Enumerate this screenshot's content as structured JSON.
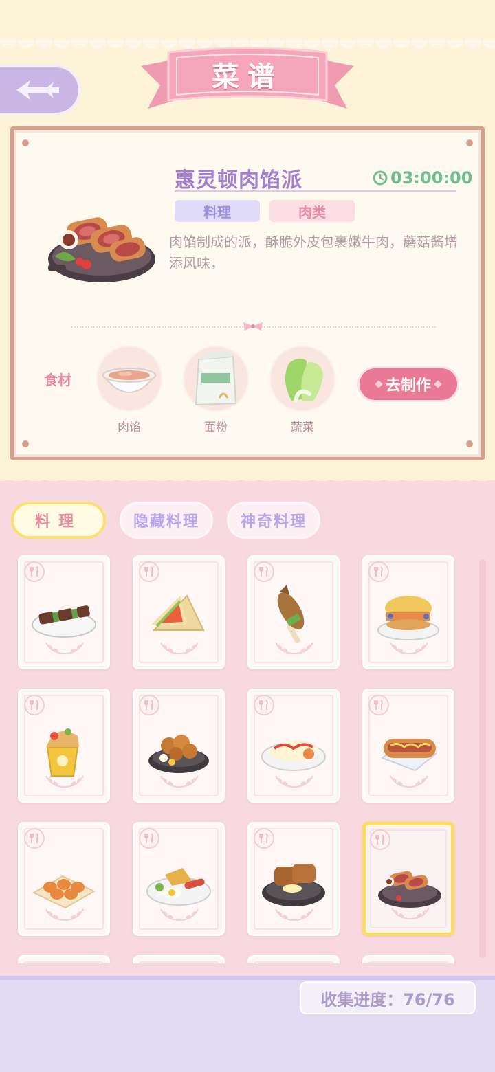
{
  "header": {
    "title": "菜谱"
  },
  "detail": {
    "dish_name": "惠灵顿肉馅派",
    "timer": "03:00:00",
    "tag_type": "料理",
    "tag_category": "肉类",
    "description": "肉馅制成的派，酥脆外皮包裹嫩牛肉，蘑菇酱增添风味，",
    "ingredients_label": "食材",
    "ingredients": [
      {
        "name": "肉馅",
        "icon": "minced-meat-bowl-icon"
      },
      {
        "name": "面粉",
        "icon": "flour-bag-icon"
      },
      {
        "name": "蔬菜",
        "icon": "cabbage-icon"
      }
    ],
    "make_button": "去制作"
  },
  "tabs": [
    {
      "label": "料理",
      "active": true
    },
    {
      "label": "隐藏料理",
      "active": false
    },
    {
      "label": "神奇料理",
      "active": false
    }
  ],
  "recipes": [
    {
      "icon": "kebab-skewers-icon"
    },
    {
      "icon": "sandwich-icon"
    },
    {
      "icon": "grilled-fish-skewer-icon"
    },
    {
      "icon": "burger-icon"
    },
    {
      "icon": "wrap-icon"
    },
    {
      "icon": "fried-chicken-icon"
    },
    {
      "icon": "omelette-icon"
    },
    {
      "icon": "hotdog-icon"
    },
    {
      "icon": "bacon-rolls-icon"
    },
    {
      "icon": "breakfast-plate-icon"
    },
    {
      "icon": "cutlet-icon"
    },
    {
      "icon": "wellington-icon",
      "selected": true
    }
  ],
  "progress": {
    "text": "收集进度：76/76",
    "collected": 76,
    "total": 76
  },
  "colors": {
    "accent_pink": "#ea7a93",
    "accent_purple": "#a47fcf",
    "timer_green": "#6fc08e",
    "selected_border": "#f8e05c"
  }
}
